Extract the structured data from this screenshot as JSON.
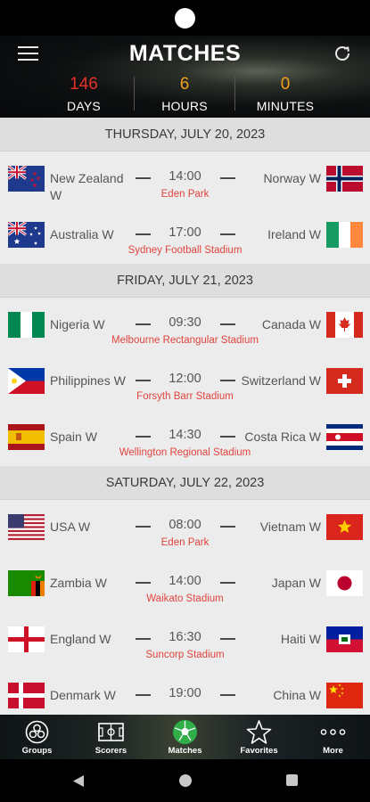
{
  "header": {
    "title": "MATCHES",
    "countdown": [
      {
        "value": "146",
        "label": "DAYS",
        "color": "#e6312b"
      },
      {
        "value": "6",
        "label": "HOURS",
        "color": "#f0a020"
      },
      {
        "value": "0",
        "label": "MINUTES",
        "color": "#f0a020"
      }
    ]
  },
  "days": [
    {
      "date": "THURSDAY, JULY 20, 2023",
      "matches": [
        {
          "home": "New Zealand W",
          "home_flag": "new-zealand-flag-icon",
          "time": "14:00",
          "away": "Norway W",
          "away_flag": "norway-flag-icon",
          "venue": "Eden Park"
        },
        {
          "home": "Australia W",
          "home_flag": "australia-flag-icon",
          "time": "17:00",
          "away": "Ireland W",
          "away_flag": "ireland-flag-icon",
          "venue": "Sydney Football Stadium"
        }
      ]
    },
    {
      "date": "FRIDAY, JULY 21, 2023",
      "matches": [
        {
          "home": "Nigeria W",
          "home_flag": "nigeria-flag-icon",
          "time": "09:30",
          "away": "Canada W",
          "away_flag": "canada-flag-icon",
          "venue": "Melbourne Rectangular Stadium"
        },
        {
          "home": "Philippines W",
          "home_flag": "philippines-flag-icon",
          "time": "12:00",
          "away": "Switzerland W",
          "away_flag": "switzerland-flag-icon",
          "venue": "Forsyth Barr Stadium"
        },
        {
          "home": "Spain W",
          "home_flag": "spain-flag-icon",
          "time": "14:30",
          "away": "Costa Rica W",
          "away_flag": "costa-rica-flag-icon",
          "venue": "Wellington Regional Stadium"
        }
      ]
    },
    {
      "date": "SATURDAY, JULY 22, 2023",
      "matches": [
        {
          "home": "USA W",
          "home_flag": "usa-flag-icon",
          "time": "08:00",
          "away": "Vietnam W",
          "away_flag": "vietnam-flag-icon",
          "venue": "Eden Park"
        },
        {
          "home": "Zambia W",
          "home_flag": "zambia-flag-icon",
          "time": "14:00",
          "away": "Japan W",
          "away_flag": "japan-flag-icon",
          "venue": "Waikato Stadium"
        },
        {
          "home": "England W",
          "home_flag": "england-flag-icon",
          "time": "16:30",
          "away": "Haiti W",
          "away_flag": "haiti-flag-icon",
          "venue": "Suncorp Stadium"
        },
        {
          "home": "Denmark W",
          "home_flag": "denmark-flag-icon",
          "time": "19:00",
          "away": "China W",
          "away_flag": "china-flag-icon",
          "venue": ""
        }
      ]
    }
  ],
  "tabs": [
    {
      "label": "Groups",
      "icon": "groups-icon"
    },
    {
      "label": "Scorers",
      "icon": "pitch-icon"
    },
    {
      "label": "Matches",
      "icon": "soccer-ball-icon"
    },
    {
      "label": "Favorites",
      "icon": "star-icon"
    },
    {
      "label": "More",
      "icon": "more-dots-icon"
    }
  ],
  "colors": {
    "accent_red": "#e0443e",
    "countdown_orange": "#f0a020",
    "countdown_red": "#e6312b",
    "active_tab_green": "#2fae4a"
  }
}
